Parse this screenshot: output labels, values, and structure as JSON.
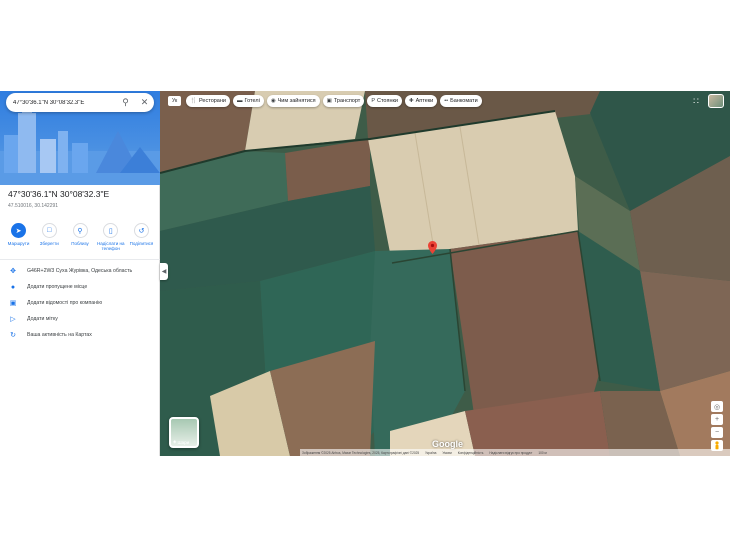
{
  "search": {
    "value": "47°30'36.1\"N 30°08'32.3\"E"
  },
  "place": {
    "title": "47°30'36.1\"N 30°08'32.3\"E",
    "subtitle": "47.510016, 30.142291"
  },
  "actions": [
    {
      "label": "Маршрути",
      "icon": "directions-icon"
    },
    {
      "label": "Зберегти",
      "icon": "bookmark-icon"
    },
    {
      "label": "Поблизу",
      "icon": "nearby-icon"
    },
    {
      "label": "Надіслати на телефон",
      "icon": "send-to-phone-icon"
    },
    {
      "label": "Поділитися",
      "icon": "share-icon"
    }
  ],
  "info_rows": [
    {
      "text": "G46R+2W3 Суха Журівка, Одеська область",
      "icon": "plus-code-icon"
    },
    {
      "text": "Додати пропущене місце",
      "icon": "add-place-icon"
    },
    {
      "text": "Додати відомості про компанію",
      "icon": "add-business-icon"
    },
    {
      "text": "Додати мітку",
      "icon": "label-icon"
    },
    {
      "text": "Ваша активність на Картах",
      "icon": "history-icon"
    }
  ],
  "map": {
    "language_button": "Ук",
    "chips": [
      {
        "label": "Ресторани",
        "icon": "restaurant-icon"
      },
      {
        "label": "Готелі",
        "icon": "hotel-icon"
      },
      {
        "label": "Чим зайнятися",
        "icon": "camera-icon"
      },
      {
        "label": "Транспорт",
        "icon": "transit-icon"
      },
      {
        "label": "Стоянки",
        "icon": "parking-icon"
      },
      {
        "label": "Аптеки",
        "icon": "pharmacy-icon"
      },
      {
        "label": "Банкомати",
        "icon": "atm-icon"
      }
    ],
    "layers_label": "Шари",
    "logo": "Google",
    "attribution": [
      "Зображення ©2025 Airbus, Maxar Technologies, 2025, Картографічні дані ©2025",
      "Україна",
      "Умови",
      "Конфіденційність",
      "Надіслати відгук про продукт",
      "100 м"
    ]
  },
  "colors": {
    "accent": "#1a73e8",
    "pin": "#ea4335"
  }
}
